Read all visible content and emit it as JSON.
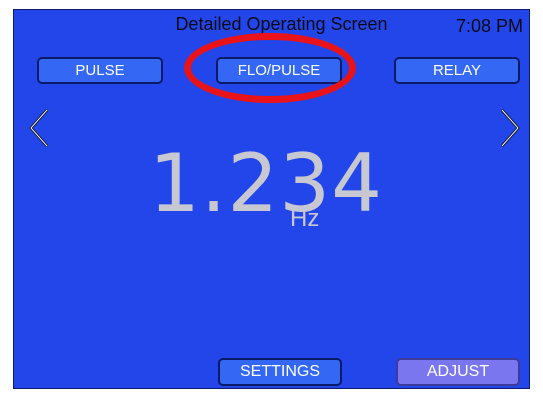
{
  "header": {
    "title": "Detailed Operating Screen",
    "time": "7:08 PM"
  },
  "tabs": [
    {
      "label": "PULSE"
    },
    {
      "label": "FLO/PULSE"
    },
    {
      "label": "RELAY"
    }
  ],
  "reading": {
    "value": "1.234",
    "unit": "Hz"
  },
  "footer": {
    "settings_label": "SETTINGS",
    "adjust_label": "ADJUST"
  },
  "icons": {
    "prev": "chevron-left-icon",
    "next": "chevron-right-icon"
  },
  "colors": {
    "background": "#2346ea",
    "button": "#3467f3",
    "adjust_button": "#7a76ef",
    "highlight": "#e8141a",
    "reading": "#c8c8d2"
  }
}
